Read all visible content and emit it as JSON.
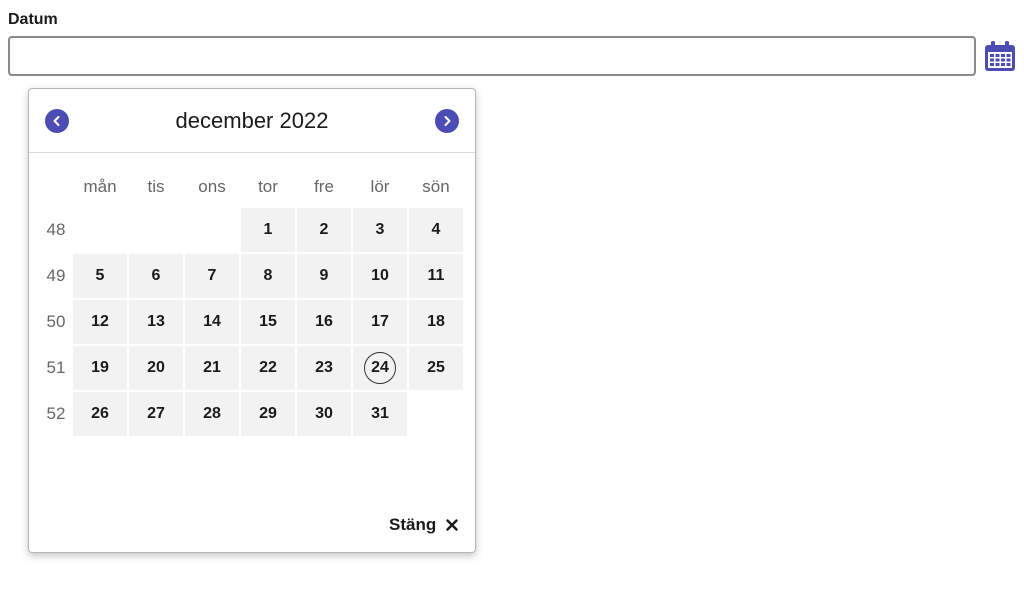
{
  "field": {
    "label": "Datum",
    "value": "",
    "placeholder": ""
  },
  "icons": {
    "calendar": "calendar-icon",
    "prev": "chevron-left-icon",
    "next": "chevron-right-icon",
    "close": "close-icon"
  },
  "colors": {
    "accent": "#4c4cb5",
    "day_bg": "#f2f2f2"
  },
  "datepicker": {
    "title": "december 2022",
    "weekdays": [
      "mån",
      "tis",
      "ons",
      "tor",
      "fre",
      "lör",
      "sön"
    ],
    "weeks": [
      {
        "number": "48",
        "days": [
          "",
          "",
          "",
          "1",
          "2",
          "3",
          "4"
        ]
      },
      {
        "number": "49",
        "days": [
          "5",
          "6",
          "7",
          "8",
          "9",
          "10",
          "11"
        ]
      },
      {
        "number": "50",
        "days": [
          "12",
          "13",
          "14",
          "15",
          "16",
          "17",
          "18"
        ]
      },
      {
        "number": "51",
        "days": [
          "19",
          "20",
          "21",
          "22",
          "23",
          "24",
          "25"
        ]
      },
      {
        "number": "52",
        "days": [
          "26",
          "27",
          "28",
          "29",
          "30",
          "31",
          ""
        ]
      }
    ],
    "today": "24",
    "close_label": "Stäng"
  }
}
